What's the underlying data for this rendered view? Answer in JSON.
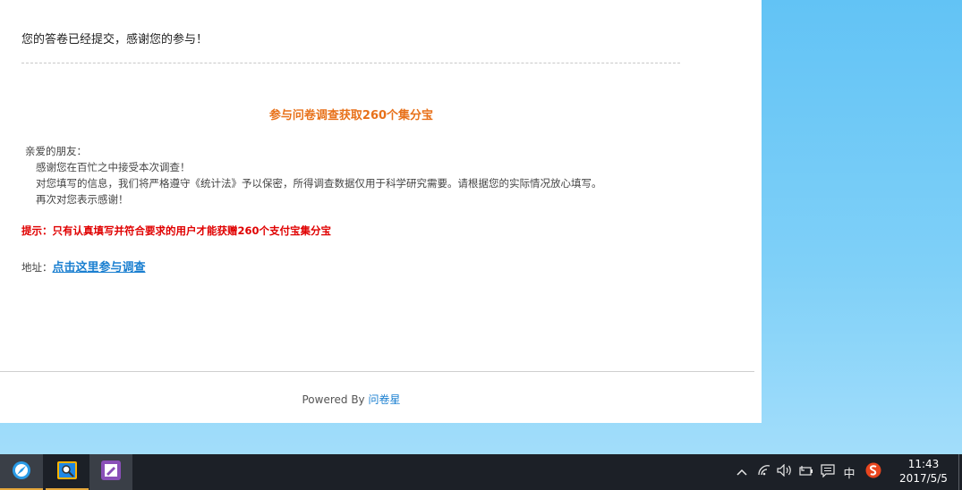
{
  "page": {
    "submitted_message": "您的答卷已经提交，感谢您的参与！",
    "promo_title": "参与问卷调查获取260个集分宝",
    "letter": {
      "greeting": "亲爱的朋友：",
      "line1": "感谢您在百忙之中接受本次调查！",
      "line2": "对您填写的信息，我们将严格遵守《统计法》予以保密，所得调查数据仅用于科学研究需要。请根据您的实际情况放心填写。",
      "line3": "再次对您表示感谢！"
    },
    "hint": "提示：只有认真填写并符合要求的用户才能获赠260个支付宝集分宝",
    "address_label": "地址：",
    "address_link": "点击这里参与调查",
    "powered_by": "Powered By",
    "brand": "问卷星"
  },
  "taskbar": {
    "apps": [
      {
        "icon": "browser-icon"
      },
      {
        "icon": "photo-viewer-icon"
      },
      {
        "icon": "notes-app-icon"
      }
    ],
    "tray": {
      "ime": "中",
      "chevron_icon": "chevron-up-icon",
      "network_icon": "wifi-icon",
      "volume_icon": "volume-icon",
      "battery_icon": "battery-icon",
      "notification_icon": "action-center-icon",
      "sogou_icon": "sogou-input-icon"
    },
    "clock": {
      "time": "11:43",
      "date": "2017/5/5"
    }
  },
  "colors": {
    "title_orange": "#e8711a",
    "hint_red": "#e00000",
    "link_blue": "#1a7fd0",
    "taskbar": "#1c2027"
  }
}
